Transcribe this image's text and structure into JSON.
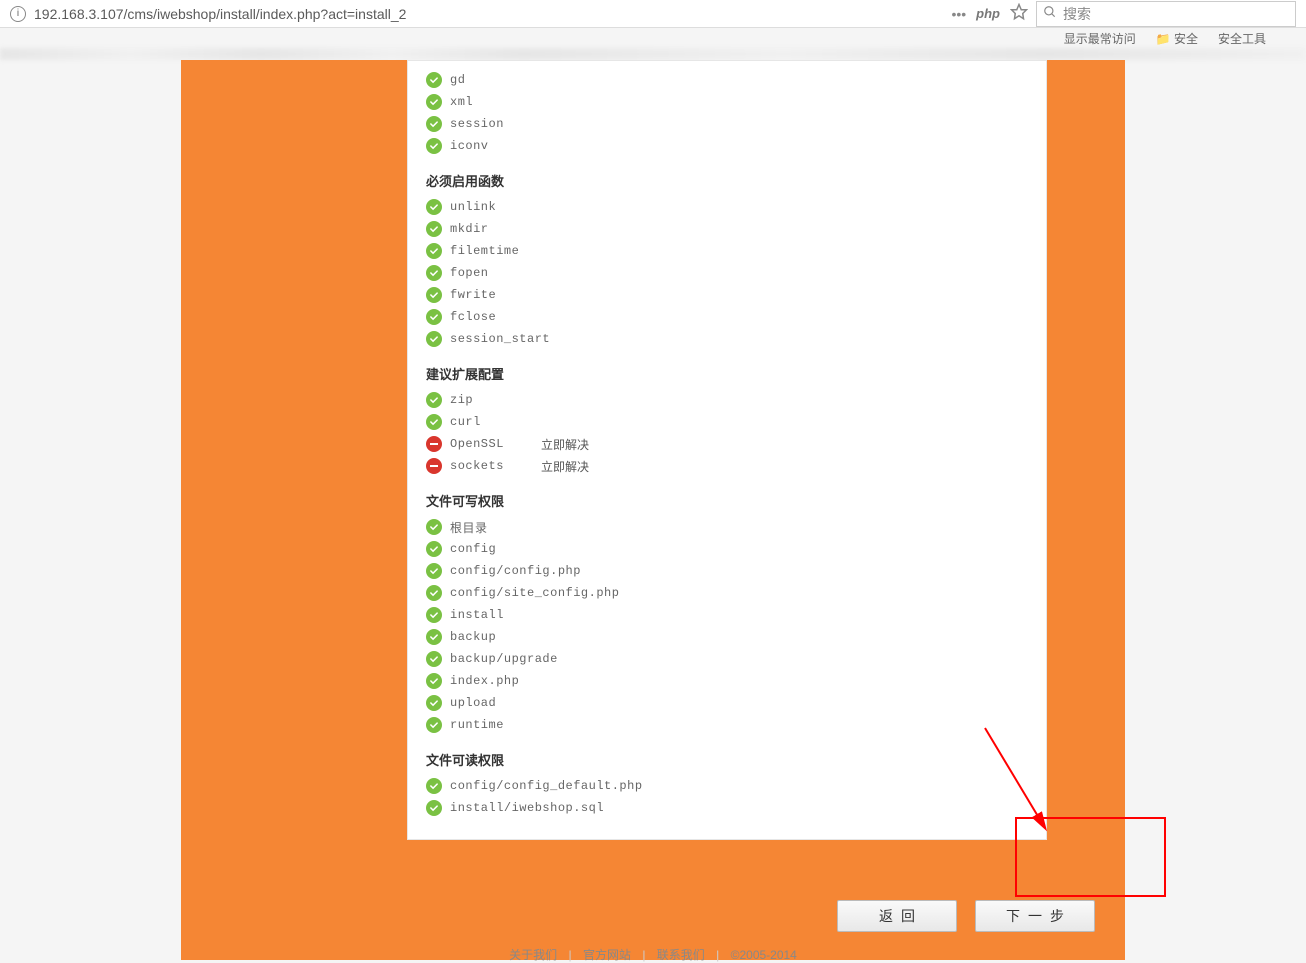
{
  "browser": {
    "url": "192.168.3.107/cms/iwebshop/install/index.php?act=install_2",
    "php_badge": "php",
    "search_placeholder": "搜索",
    "bookmark1": "📁 安全",
    "bookmark2": "安全工具",
    "bookmark_prefix": "显示最常访问"
  },
  "sections": [
    {
      "title": null,
      "items": [
        {
          "status": "ok",
          "name": "gd",
          "action": ""
        },
        {
          "status": "ok",
          "name": "xml",
          "action": ""
        },
        {
          "status": "ok",
          "name": "session",
          "action": ""
        },
        {
          "status": "ok",
          "name": "iconv",
          "action": ""
        }
      ]
    },
    {
      "title": "必须启用函数",
      "items": [
        {
          "status": "ok",
          "name": "unlink",
          "action": ""
        },
        {
          "status": "ok",
          "name": "mkdir",
          "action": ""
        },
        {
          "status": "ok",
          "name": "filemtime",
          "action": ""
        },
        {
          "status": "ok",
          "name": "fopen",
          "action": ""
        },
        {
          "status": "ok",
          "name": "fwrite",
          "action": ""
        },
        {
          "status": "ok",
          "name": "fclose",
          "action": ""
        },
        {
          "status": "ok",
          "name": "session_start",
          "action": ""
        }
      ]
    },
    {
      "title": "建议扩展配置",
      "items": [
        {
          "status": "ok",
          "name": "zip",
          "action": ""
        },
        {
          "status": "ok",
          "name": "curl",
          "action": ""
        },
        {
          "status": "err",
          "name": "OpenSSL",
          "action": "立即解决"
        },
        {
          "status": "err",
          "name": "sockets",
          "action": "立即解决"
        }
      ]
    },
    {
      "title": "文件可写权限",
      "items": [
        {
          "status": "ok",
          "name": "根目录",
          "action": ""
        },
        {
          "status": "ok",
          "name": "config",
          "action": ""
        },
        {
          "status": "ok",
          "name": "config/config.php",
          "action": ""
        },
        {
          "status": "ok",
          "name": "config/site_config.php",
          "action": ""
        },
        {
          "status": "ok",
          "name": "install",
          "action": ""
        },
        {
          "status": "ok",
          "name": "backup",
          "action": ""
        },
        {
          "status": "ok",
          "name": "backup/upgrade",
          "action": ""
        },
        {
          "status": "ok",
          "name": "index.php",
          "action": ""
        },
        {
          "status": "ok",
          "name": "upload",
          "action": ""
        },
        {
          "status": "ok",
          "name": "runtime",
          "action": ""
        }
      ]
    },
    {
      "title": "文件可读权限",
      "items": [
        {
          "status": "ok",
          "name": "config/config_default.php",
          "action": ""
        },
        {
          "status": "ok",
          "name": "install/iwebshop.sql",
          "action": ""
        }
      ]
    }
  ],
  "buttons": {
    "back": "返回",
    "next": "下一步"
  },
  "footer": {
    "about": "关于我们",
    "site": "官方网站",
    "contact": "联系我们",
    "copy": "©2005-2014"
  }
}
